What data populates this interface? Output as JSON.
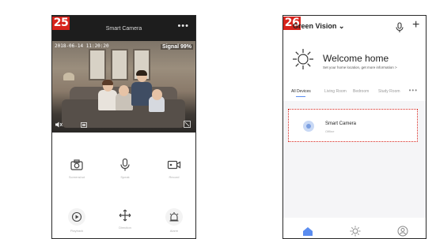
{
  "steps": {
    "left": "25",
    "right": "26"
  },
  "camera_screen": {
    "title": "Smart  Camera",
    "more": "•••",
    "timestamp": "2018-06-14 11:20:20",
    "signal": "Signal 99%",
    "controls": [
      {
        "icon": "camera-icon",
        "label": "Screenshot"
      },
      {
        "icon": "microphone-icon",
        "label": "Speak"
      },
      {
        "icon": "record-icon",
        "label": "Record"
      },
      {
        "icon": "playback-icon",
        "label": "Playback"
      },
      {
        "icon": "move-icon",
        "label": "Direction"
      },
      {
        "icon": "alarm-icon",
        "label": "Alarm"
      }
    ]
  },
  "home_screen": {
    "home_name": "Green  Vision",
    "welcome_title": "Welcome  home",
    "welcome_subtitle": "Set your home location, get more information >",
    "tabs": [
      {
        "label": "All  Devices",
        "active": true
      },
      {
        "label": "Living Room",
        "active": false
      },
      {
        "label": "Bedroom",
        "active": false
      },
      {
        "label": "Study Room",
        "active": false
      }
    ],
    "tabs_more": "•••",
    "device": {
      "name": "Smart  Camera",
      "status": "Offline"
    }
  },
  "colors": {
    "badge": "#d7231c",
    "accent": "#5b8df0",
    "dark": "#1d1d1d"
  }
}
